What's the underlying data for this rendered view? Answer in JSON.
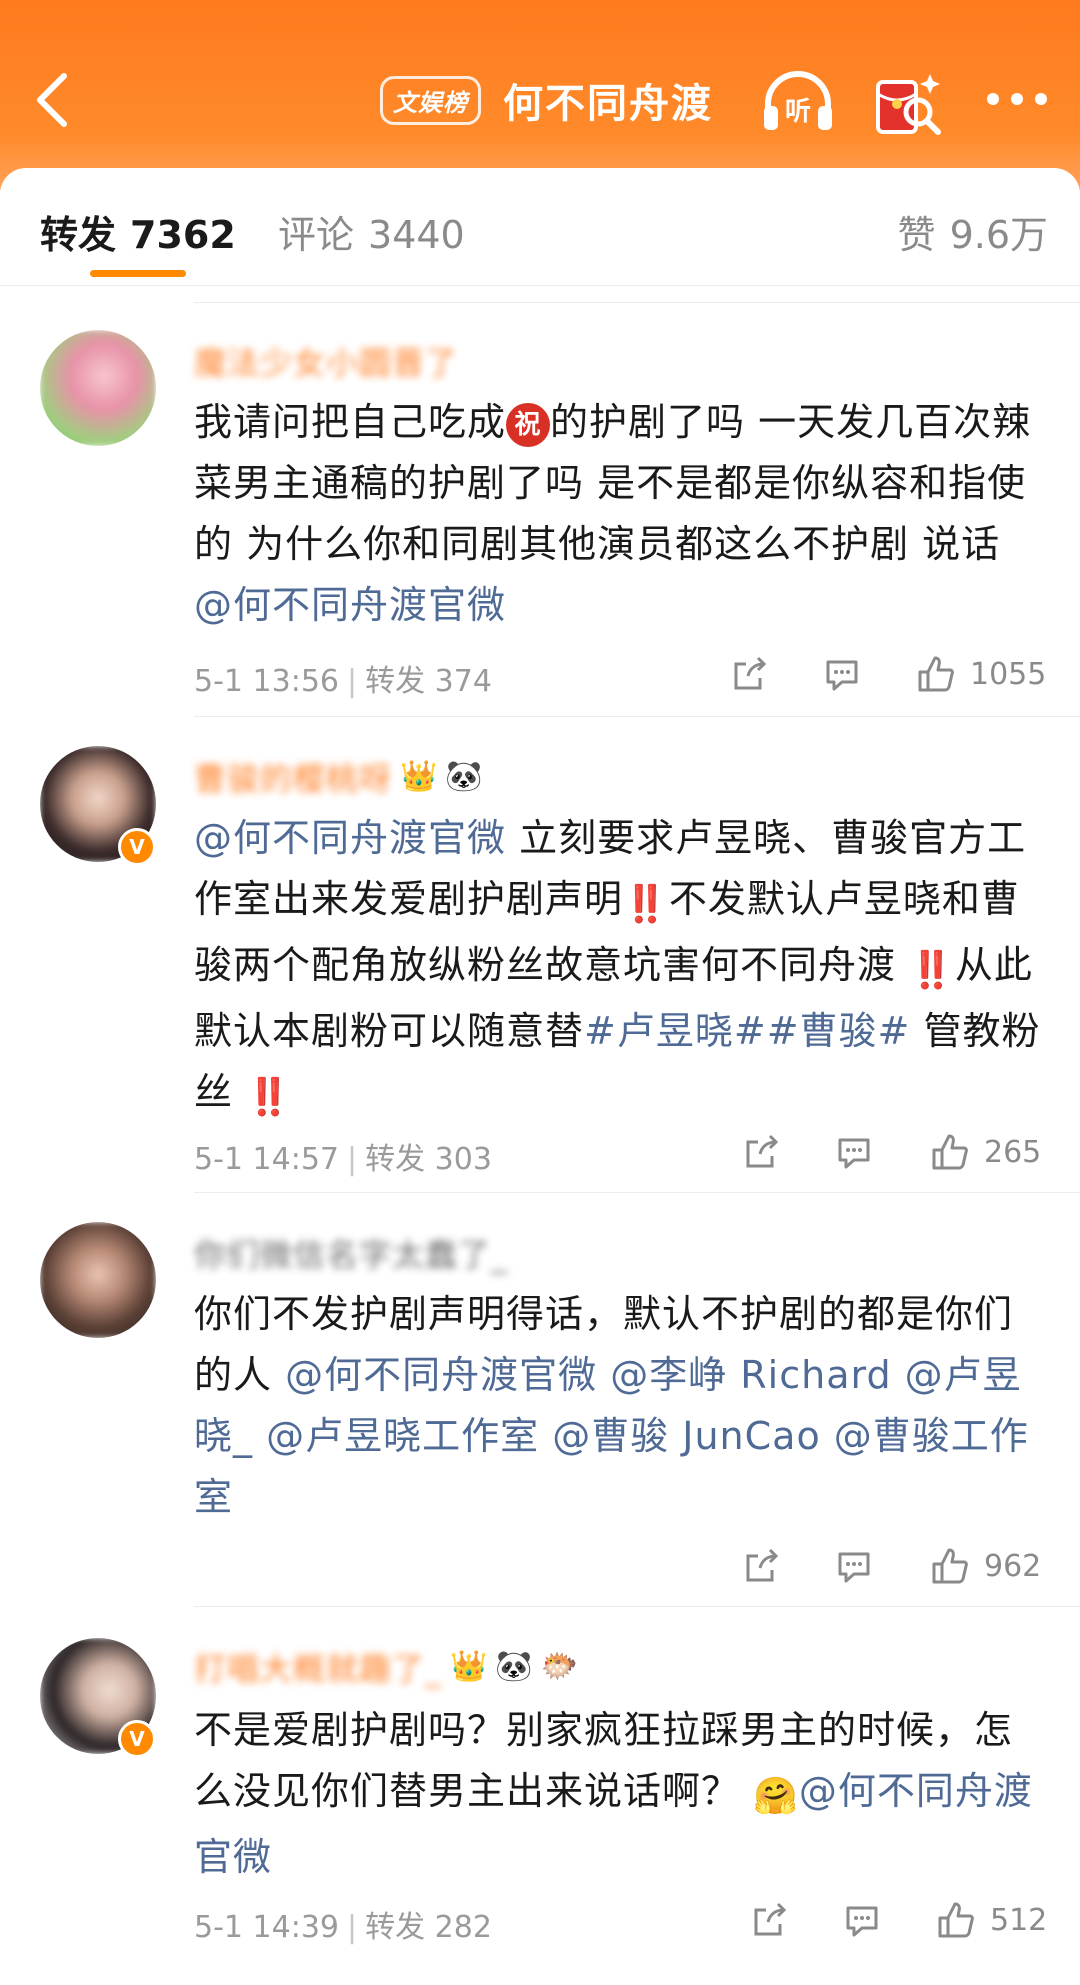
{
  "header": {
    "badge": "文娱榜",
    "title": "何不同舟渡"
  },
  "tabs": {
    "repost_label": "转发",
    "repost_count": "7362",
    "comment_label": "评论",
    "comment_count": "3440",
    "likes_label": "赞",
    "likes_count": "9.6万"
  },
  "comments": [
    {
      "username": "魔法少女小圆晋了",
      "text_a": "我请问把自己吃成",
      "icon": "祝",
      "text_b": "的护剧了吗 一天发几百次辣菜男主通稿的护剧了吗 是不是都是你纵容和指使的 为什么你和同剧其他演员都这么不护剧 说话 ",
      "mention": "@何不同舟渡官微",
      "time": "5-1 13:56",
      "repost_label": "转发",
      "repost_count": "374",
      "likes": "1055"
    },
    {
      "username": "曹骏的樱桃呀",
      "badges": [
        "👑",
        "🐼"
      ],
      "mention_1": "@何不同舟渡官微",
      "text_a": " 立刻要求卢昱晓、曹骏官方工作室出来发爱剧护剧声明",
      "alert_1": "‼️",
      "text_b": "不发默认卢昱晓和曹骏两个配角放纵粉丝故意坑害何不同舟渡 ",
      "alert_2": "‼️",
      "text_c": "从此默认本剧粉可以随意替",
      "hashtag_1": "#卢昱晓#",
      "hashtag_2": "#曹骏#",
      "text_d": " 管教粉丝 ",
      "alert_3": "‼️",
      "time": "5-1 14:57",
      "repost_label": "转发",
      "repost_count": "303",
      "likes": "265"
    },
    {
      "username": "你们微信名字太蠢了_",
      "text_a": "你们不发护剧声明得话，默认不护剧的都是你们的人 ",
      "mention_1": "@何不同舟渡官微",
      "mention_2": " @李峥 Richard",
      "mention_3": " @卢昱晓_",
      "mention_4": " @卢昱晓工作室",
      "mention_5": " @曹骏 JunCao",
      "mention_6": " @曹骏工作室",
      "time": "",
      "likes": "962"
    },
    {
      "username": "打唱大概就趣了_",
      "badges": [
        "👑",
        "🐼",
        "🐡"
      ],
      "text_a": "不是爱剧护剧吗？别家疯狂拉踩男主的时候，怎么没见你们替男主出来说话啊？ ",
      "emoji": "🤗",
      "mention": "@何不同舟渡官微",
      "time": "5-1 14:39",
      "repost_label": "转发",
      "repost_count": "282",
      "likes": "512"
    }
  ],
  "colors": {
    "header_orange": "#ff7a1e",
    "tab_underline": "#ff8a00",
    "mention_blue": "#4f6a95",
    "verified_badge": "#ff8a00"
  }
}
